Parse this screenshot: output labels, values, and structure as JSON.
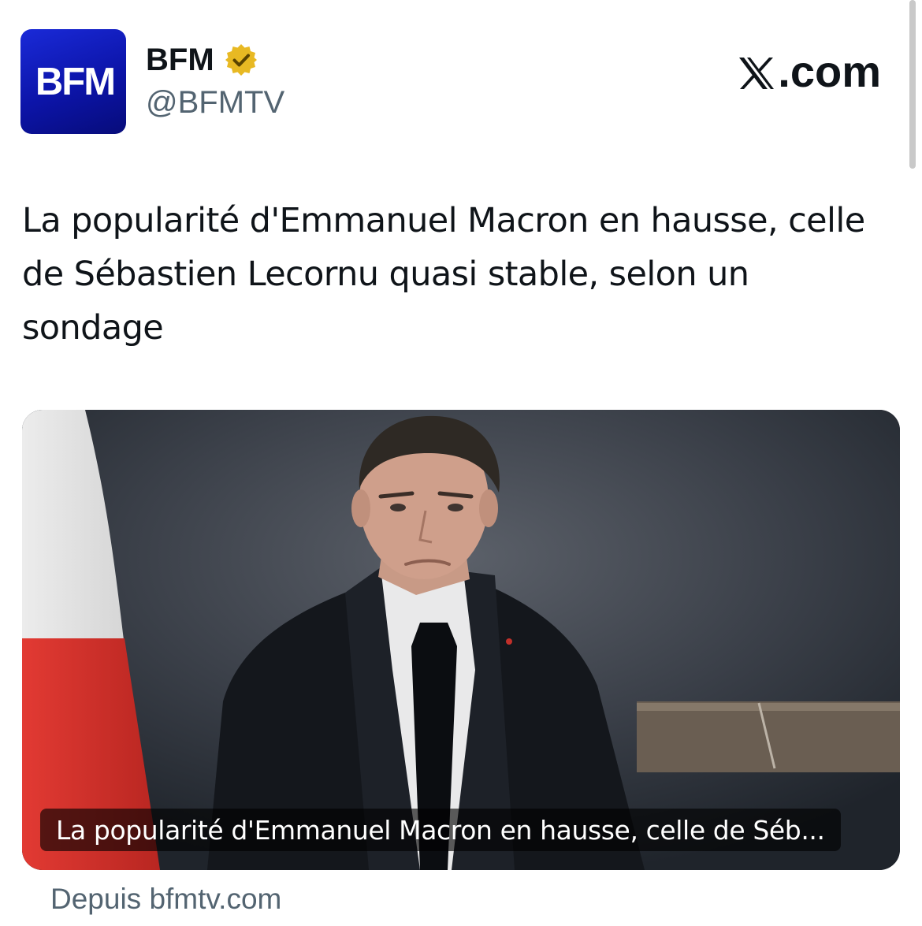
{
  "account": {
    "avatar_text": "BFM",
    "display_name": "BFM",
    "handle": "@BFMTV",
    "verified": true,
    "verified_icon": "verified-badge-gold"
  },
  "brand": {
    "label": ".com",
    "icon": "x-logo"
  },
  "post": {
    "text": "La popularité d'Emmanuel Macron en hausse, celle de Sébastien Lecornu quasi stable, selon un sondage"
  },
  "card": {
    "caption": "La popularité d'Emmanuel Macron en hausse, celle de Séb...",
    "source": "Depuis bfmtv.com"
  },
  "colors": {
    "avatar_bg": "#1a2ad8",
    "verified": "#e8b923",
    "text": "#0f1419",
    "secondary_text": "#536471",
    "flag_white": "#f4f4f4",
    "flag_red": "#d8322c"
  }
}
